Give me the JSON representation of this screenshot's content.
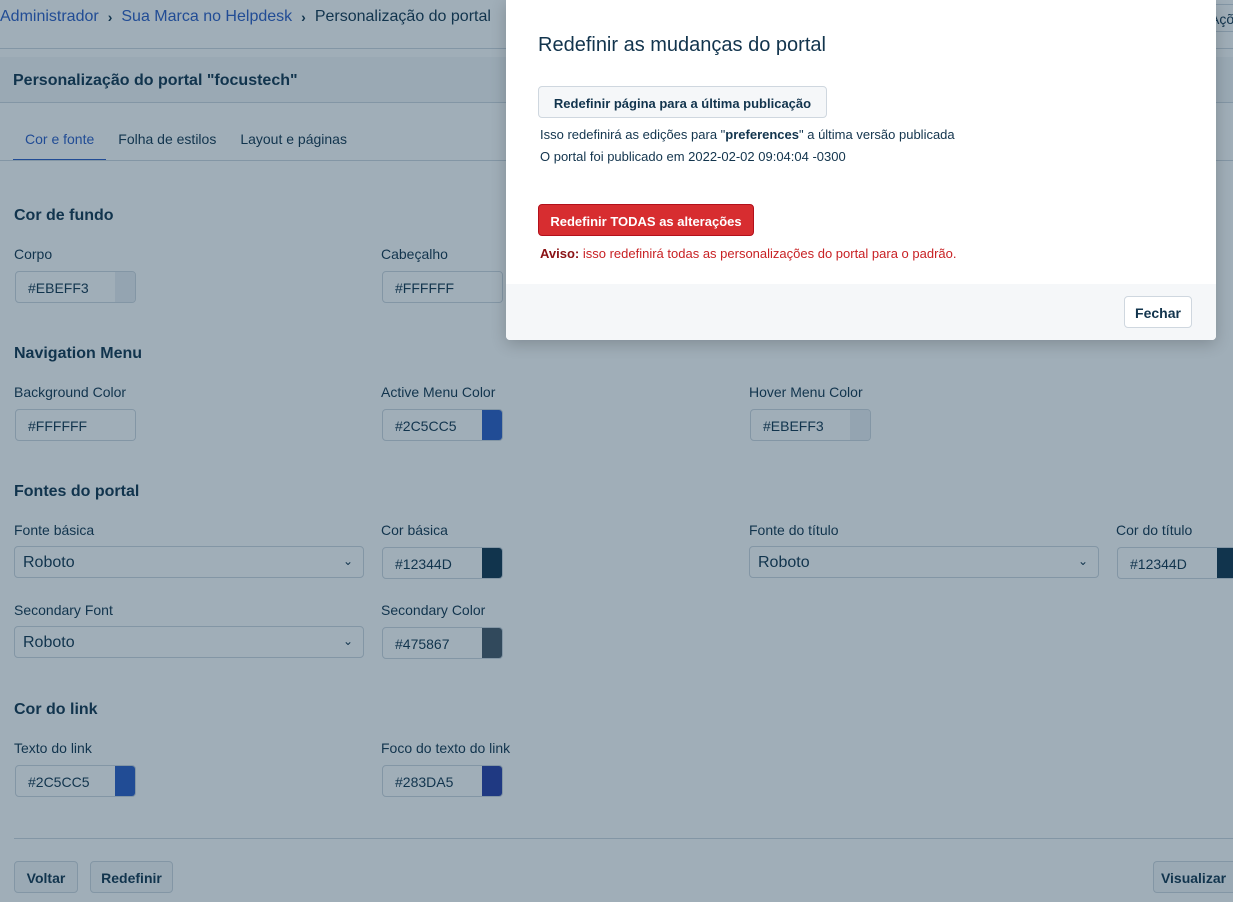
{
  "breadcrumb": {
    "items": [
      "Administrador",
      "Sua Marca no Helpdesk"
    ],
    "current": "Personalização do portal",
    "separator": "›"
  },
  "top_right_button": "Ações pa",
  "page_title": "Personalização do portal \"focustech\"",
  "tabs": [
    {
      "label": "Cor e fonte",
      "active": true
    },
    {
      "label": "Folha de estilos",
      "active": false
    },
    {
      "label": "Layout e páginas",
      "active": false
    }
  ],
  "sections": {
    "background": {
      "title": "Cor de fundo",
      "fields": [
        {
          "label": "Corpo",
          "value": "#EBEFF3",
          "swatch": "#EBEFF3"
        },
        {
          "label": "Cabeçalho",
          "value": "#FFFFFF",
          "swatch": "#FFFFFF"
        }
      ]
    },
    "nav_menu": {
      "title": "Navigation Menu",
      "fields": [
        {
          "label": "Background Color",
          "value": "#FFFFFF",
          "swatch": "#FFFFFF"
        },
        {
          "label": "Active Menu Color",
          "value": "#2C5CC5",
          "swatch": "#2C5CC5"
        },
        {
          "label": "Hover Menu Color",
          "value": "#EBEFF3",
          "swatch": "#EBEFF3"
        }
      ]
    },
    "fonts": {
      "title": "Fontes do portal",
      "base_font_label": "Fonte básica",
      "base_font_value": "Roboto",
      "base_color_label": "Cor básica",
      "base_color_value": "#12344D",
      "title_font_label": "Fonte do título",
      "title_font_value": "Roboto",
      "title_color_label": "Cor do título",
      "title_color_value": "#12344D",
      "secondary_font_label": "Secondary Font",
      "secondary_font_value": "Roboto",
      "secondary_color_label": "Secondary Color",
      "secondary_color_value": "#475867"
    },
    "link": {
      "title": "Cor do link",
      "fields": [
        {
          "label": "Texto do link",
          "value": "#2C5CC5",
          "swatch": "#2C5CC5"
        },
        {
          "label": "Foco do texto do link",
          "value": "#283DA5",
          "swatch": "#283DA5"
        }
      ]
    }
  },
  "footer": {
    "back": "Voltar",
    "reset": "Redefinir",
    "preview": "Visualizar"
  },
  "modal": {
    "title": "Redefinir as mudanças do portal",
    "reset_page_button": "Redefinir página para a última publicação",
    "info_prefix": "Isso redefinirá as edições para \"",
    "info_bold": "preferences",
    "info_suffix": "\" a última versão publicada",
    "published_text": "O portal foi publicado em 2022-02-02 09:04:04 -0300",
    "reset_all_button": "Redefinir TODAS as alterações",
    "warning_label": "Aviso:",
    "warning_text": " isso redefinirá todas as personalizações do portal para o padrão.",
    "close_button": "Fechar"
  },
  "colors": {
    "accent": "#2C5CC5",
    "danger": "#D72D30",
    "text": "#12344D"
  }
}
